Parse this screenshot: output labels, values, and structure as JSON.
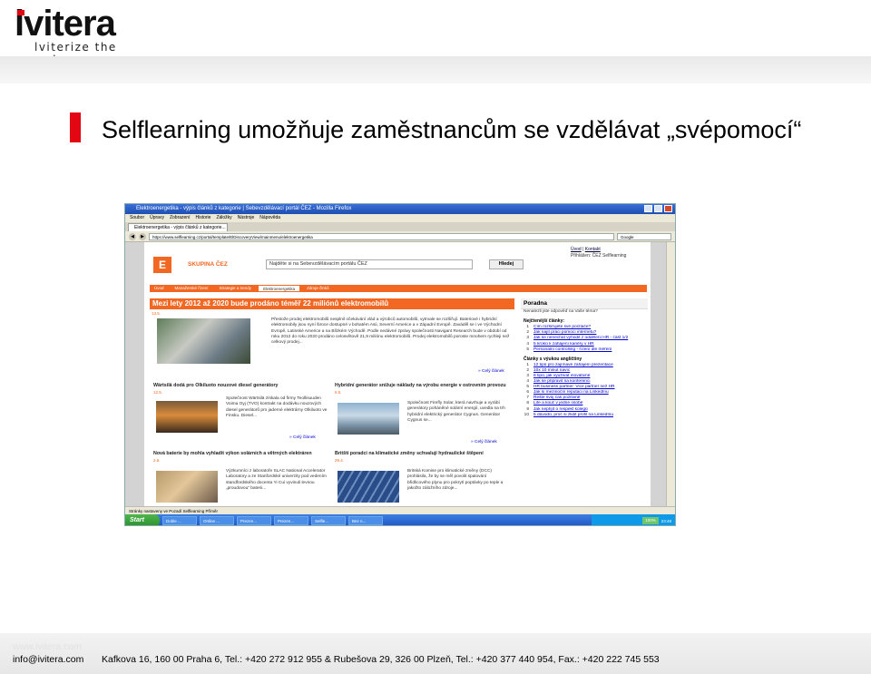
{
  "logo": {
    "word": "lvitera",
    "tagline": "lviterize the web"
  },
  "slide": {
    "title": "Selflearning umožňuje zaměstnancům se vzdělávat „svépomocí“"
  },
  "browser": {
    "window_title": "Elektroenergetika - výpis článků z kategorie | Sebevzdělávací portál ČEZ - Mozilla Firefox",
    "menu": [
      "Soubor",
      "Úpravy",
      "Zobrazení",
      "Historie",
      "Záložky",
      "Nástroje",
      "Nápověda"
    ],
    "tab": "Elektroenergetika - výpis článků z kategorie...",
    "url": "https://www.selflearning.cz/portal/template/ElDiscoveryView/mainmenu/elektroenergetika",
    "search_engine": "Google",
    "status": "Stránky nastaveny ve Pozadí Selflearning Příměr",
    "taskbar": {
      "start": "Start",
      "tasks": [
        "Doble ...",
        "Online ...",
        "Prezen...",
        "Prezen...",
        "Selfle...",
        "Bez n..."
      ],
      "battery": "100%",
      "clock": "23:48"
    }
  },
  "cez": {
    "brand": "SKUPINA ČEZ",
    "search_placeholder": "Najděte si na Sebevzdělávacím portálu ČEZ",
    "search_button": "Hledej",
    "top_links": [
      "Úvod",
      "Kontakt"
    ],
    "user": "Přihlášen: ČEZ Selflearning",
    "nav": [
      "Úvod",
      "Manažerské řízení",
      "Strategie a trendy",
      "Elektroenergetika",
      "Zdroje člnků"
    ],
    "article": {
      "title": "Mezi lety 2012 až 2020 bude prodáno téměř 22 miliónů elektromobilů",
      "date": "13.5.",
      "text": "Přestože prodej elektromobilů nesplnil očekávání vlád a výrobců automobilů, vytrvale se rozšiřují. Bateriové i hybridní elektromobily jsou nyní široce dostupné v bohatém Asii, Severní Americe a v Západní Evropě. Zaváděl se i ve Východní Evropě, Latinské Americe a na Blízkém Východě. Podle nedávné zprávy společnosti Navigant Research bude v období od roku 2012 do roku 2020 prodáno celosvětově 21,9 miliónu elektromobilů. Prodej elektromobilů poroste mnohem rychleji než celkový prodej...",
      "more": "» Celý článek"
    },
    "cards": [
      {
        "title": "Wärtsilä dodá pro Olkiluoto nouzové diesel generátory",
        "date": "12.5.",
        "text": "Společnost Wärtsilä získala od firmy Teollisuuden Voima Oyj (TVO) kontrakt na dodávku nouzových diesel generátorů pro jaderné elektrárny Olkiluoto ve Finsku. Diesel...",
        "more": "» Celý článek"
      },
      {
        "title": "Hybridní generátor snižuje náklady na výrobu energie v ostrovním provozu",
        "date": "6.5.",
        "text": "Společnost Firefly Solar, která navrhuje a vyrábí generátory poháněné solární energií, uvedla na trh hybridní elektrický generátor Cygnus. Generátor Cygnus se...",
        "more": "» Celý článek"
      },
      {
        "title": "Nová baterie by mohla vyhladit výkon solárních a větrných elektráren",
        "date": "2.5.",
        "text": "Výzkumníci z laboratoře SLAC National Accelerator Laboratory a ze Stanfordské univerzity pod vedením standfordského docenta Yi Cui vyvinuli levnou „proudovou“ baterii...",
        "more": ""
      },
      {
        "title": "Britští poradci na klimatické změny schvalují hydraulické štěpení",
        "date": "29.4.",
        "text": "Britská Komise pro klimatické změny (DCC) prohlásila, že by se měl povolit spalování břidlicového plynu pro pokrytí poptávky po teple a jakožto záložního zdroje...",
        "more": ""
      }
    ],
    "sidebar": {
      "poll_title": "Poradna",
      "poll_text": "Nenalezli jste odpověď na Vaše téma?",
      "latest_title": "Nejčtenější články:",
      "latest": [
        {
          "n": "1",
          "t": "Čím rozšiřujete své počítače?"
        },
        {
          "n": "2",
          "t": "Jak najít práci pomocí internetu?"
        },
        {
          "n": "3",
          "t": "Jak se nenechat vyhodit z oddělení HR - část 1/2"
        },
        {
          "n": "4",
          "t": "5 kroků k zahájení kariéry v HR"
        },
        {
          "n": "5",
          "t": "Personální controlling - řízení dle měření"
        }
      ],
      "courses_title": "Články s výukou angličtiny",
      "courses": [
        {
          "n": "1",
          "t": "12 tipů pro zajímavé zahájení prezentace"
        },
        {
          "n": "2",
          "t": "10x 10 minut navíc"
        },
        {
          "n": "3",
          "t": "8 tipů, jak využívat inovativně"
        },
        {
          "n": "4",
          "t": "Jak se připravit na konferenci"
        },
        {
          "n": "5",
          "t": "HR business partner: Vice partner než HR"
        },
        {
          "n": "6",
          "t": "Jak si mezinoční reputaci na LinkedInu"
        },
        {
          "n": "7",
          "t": "Řešte svůj čas pozitivně"
        },
        {
          "n": "8",
          "t": "Life a kouč v jedné osobě"
        },
        {
          "n": "9",
          "t": "Jak nepřijít o respekt kolegů"
        },
        {
          "n": "10",
          "t": "5 důvodů, proč si zlidit profil na LinkedInu"
        }
      ]
    }
  },
  "footer": {
    "url": "www.ivitera.com",
    "email": "info@ivitera.com",
    "address": "Kafkova 16, 160 00 Praha 6, Tel.: +420 272 912 955  &  Rubešova 29, 326 00 Plzeň, Tel.: +420 377 440 954, Fax.: +420 222 745 553"
  }
}
